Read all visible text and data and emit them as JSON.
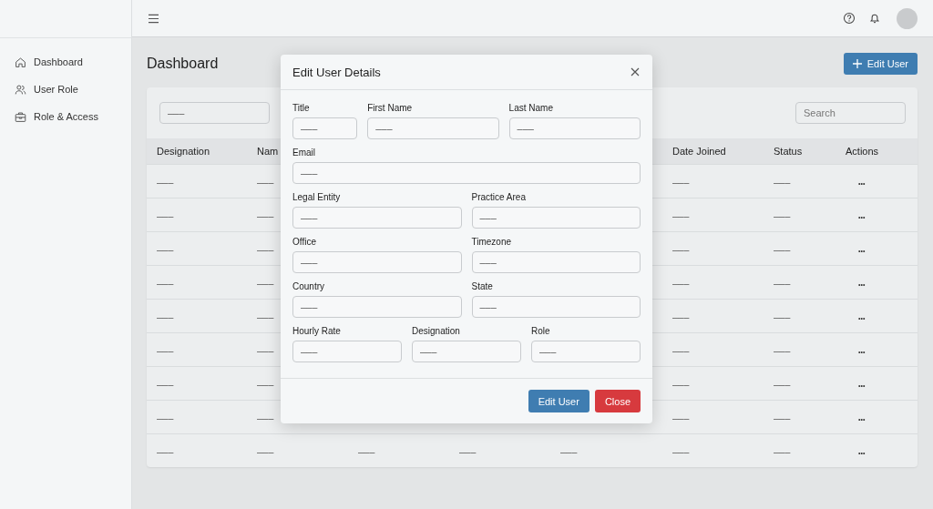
{
  "sidebar": {
    "items": [
      {
        "label": "Dashboard"
      },
      {
        "label": "User Role"
      },
      {
        "label": "Role & Access"
      }
    ]
  },
  "page": {
    "title": "Dashboard",
    "add_button": "Edit User"
  },
  "filter": {
    "value": "–––"
  },
  "search": {
    "placeholder": "Search"
  },
  "table": {
    "columns": [
      "Designation",
      "Nam",
      null,
      null,
      null,
      "Date Joined",
      "Status",
      "Actions"
    ],
    "rows": [
      [
        "–––",
        "–––",
        null,
        null,
        null,
        "–––",
        "–––",
        "•••"
      ],
      [
        "–––",
        "–––",
        null,
        null,
        null,
        "–––",
        "–––",
        "•••"
      ],
      [
        "–––",
        "–––",
        null,
        null,
        null,
        "–––",
        "–––",
        "•••"
      ],
      [
        "–––",
        "–––",
        null,
        null,
        null,
        "–––",
        "–––",
        "•••"
      ],
      [
        "–––",
        "–––",
        null,
        null,
        null,
        "–––",
        "–––",
        "•••"
      ],
      [
        "–––",
        "–––",
        null,
        null,
        null,
        "–––",
        "–––",
        "•••"
      ],
      [
        "–––",
        "–––",
        null,
        null,
        null,
        "–––",
        "–––",
        "•••"
      ],
      [
        "–––",
        "–––",
        null,
        null,
        null,
        "–––",
        "–––",
        "•••"
      ],
      [
        "–––",
        "–––",
        "–––",
        "–––",
        "–––",
        "–––",
        "–––",
        "•••"
      ]
    ]
  },
  "modal": {
    "title": "Edit User Details",
    "rows": [
      [
        {
          "label": "Title",
          "value": "–––"
        },
        {
          "label": "First Name",
          "value": "–––"
        },
        {
          "label": "Last Name",
          "value": "–––"
        }
      ],
      [
        {
          "label": "Email",
          "value": "–––"
        }
      ],
      [
        {
          "label": "Legal Entity",
          "value": "–––"
        },
        {
          "label": "Practice Area",
          "value": "–––"
        }
      ],
      [
        {
          "label": "Office",
          "value": "–––"
        },
        {
          "label": "Timezone",
          "value": "–––"
        }
      ],
      [
        {
          "label": "Country",
          "value": "–––"
        },
        {
          "label": "State",
          "value": "–––"
        }
      ],
      [
        {
          "label": "Hourly Rate",
          "value": "–––"
        },
        {
          "label": "Designation",
          "value": "–––"
        },
        {
          "label": "Role",
          "value": "–––"
        }
      ]
    ],
    "buttons": [
      {
        "kind": "primary",
        "label": "Edit User"
      },
      {
        "kind": "danger",
        "label": "Close"
      }
    ]
  }
}
